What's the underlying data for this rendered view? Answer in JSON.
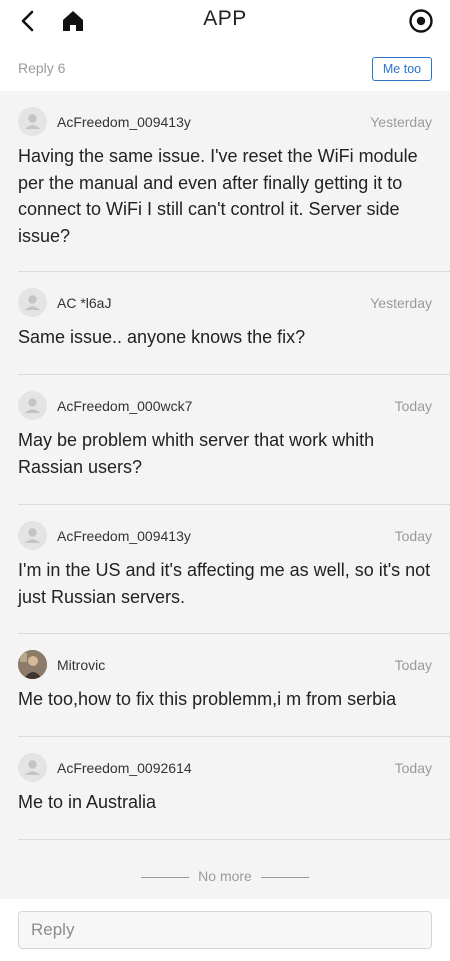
{
  "header": {
    "title": "APP",
    "back_icon": "back-arrow-icon",
    "home_icon": "home-icon",
    "more_icon": "target-circle-icon"
  },
  "reply_bar": {
    "count_label": "Reply 6",
    "me_too_label": "Me too",
    "accent_color": "#2c74c9"
  },
  "comments": [
    {
      "user": "AcFreedom_009413y",
      "time": "Yesterday",
      "text": "Having the same issue. I've reset the WiFi module per the manual and even after finally getting it to connect to WiFi I still can't control it. Server side issue?",
      "avatar": "default-user-icon"
    },
    {
      "user": "AC *l6aJ",
      "time": "Yesterday",
      "text": "Same issue.. anyone knows the fix?",
      "avatar": "default-user-icon"
    },
    {
      "user": "AcFreedom_000wck7",
      "time": "Today",
      "text": "May be problem whith server that work whith Rassian users?",
      "avatar": "default-user-icon"
    },
    {
      "user": "AcFreedom_009413y",
      "time": "Today",
      "text": "I'm in the US and it's affecting me as well, so it's not just Russian servers.",
      "avatar": "default-user-icon"
    },
    {
      "user": "Mitrovic",
      "time": "Today",
      "text": "Me too,how to fix this problemm,i m from serbia",
      "avatar": "photo-avatar"
    },
    {
      "user": "AcFreedom_0092614",
      "time": "Today",
      "text": "Me to in Australia",
      "avatar": "default-user-icon"
    }
  ],
  "list_end_label": "No more",
  "footer": {
    "reply_placeholder": "Reply"
  }
}
